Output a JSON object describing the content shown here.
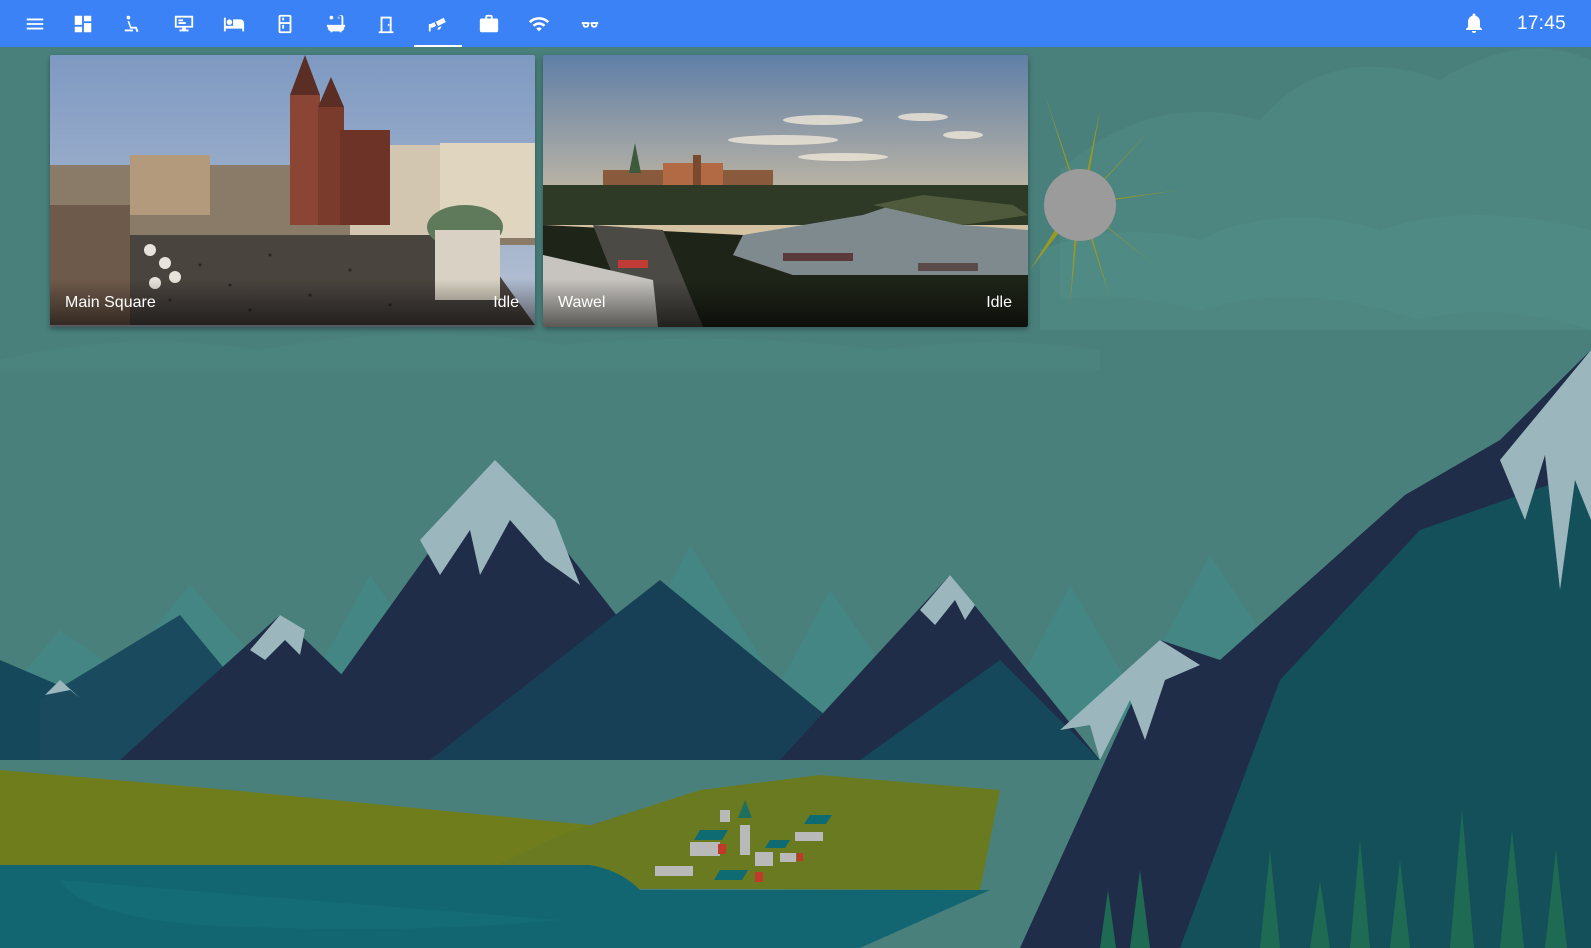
{
  "header": {
    "tabs": [
      {
        "icon": "menu-icon",
        "active": false
      },
      {
        "icon": "dashboard-icon",
        "active": false
      },
      {
        "icon": "wheelchair-seat-icon",
        "active": false
      },
      {
        "icon": "desktop-monitor-icon",
        "active": false
      },
      {
        "icon": "bed-icon",
        "active": false
      },
      {
        "icon": "fridge-icon",
        "active": false
      },
      {
        "icon": "bathtub-icon",
        "active": false
      },
      {
        "icon": "door-icon",
        "active": false
      },
      {
        "icon": "security-camera-icon",
        "active": true
      },
      {
        "icon": "briefcase-icon",
        "active": false
      },
      {
        "icon": "wifi-icon",
        "active": false
      },
      {
        "icon": "glasses-icon",
        "active": false
      }
    ],
    "notifications_icon": "bell-icon",
    "time": "17:45"
  },
  "cameras": [
    {
      "name": "Main Square",
      "state": "Idle"
    },
    {
      "name": "Wawel",
      "state": "Idle"
    }
  ],
  "colors": {
    "header": "#3b82f6",
    "sky": "#4a807c",
    "sun": "#9a9a23",
    "mountain_dark": "#1f2d48",
    "meadow": "#6f7d1c",
    "lake": "#126672"
  }
}
